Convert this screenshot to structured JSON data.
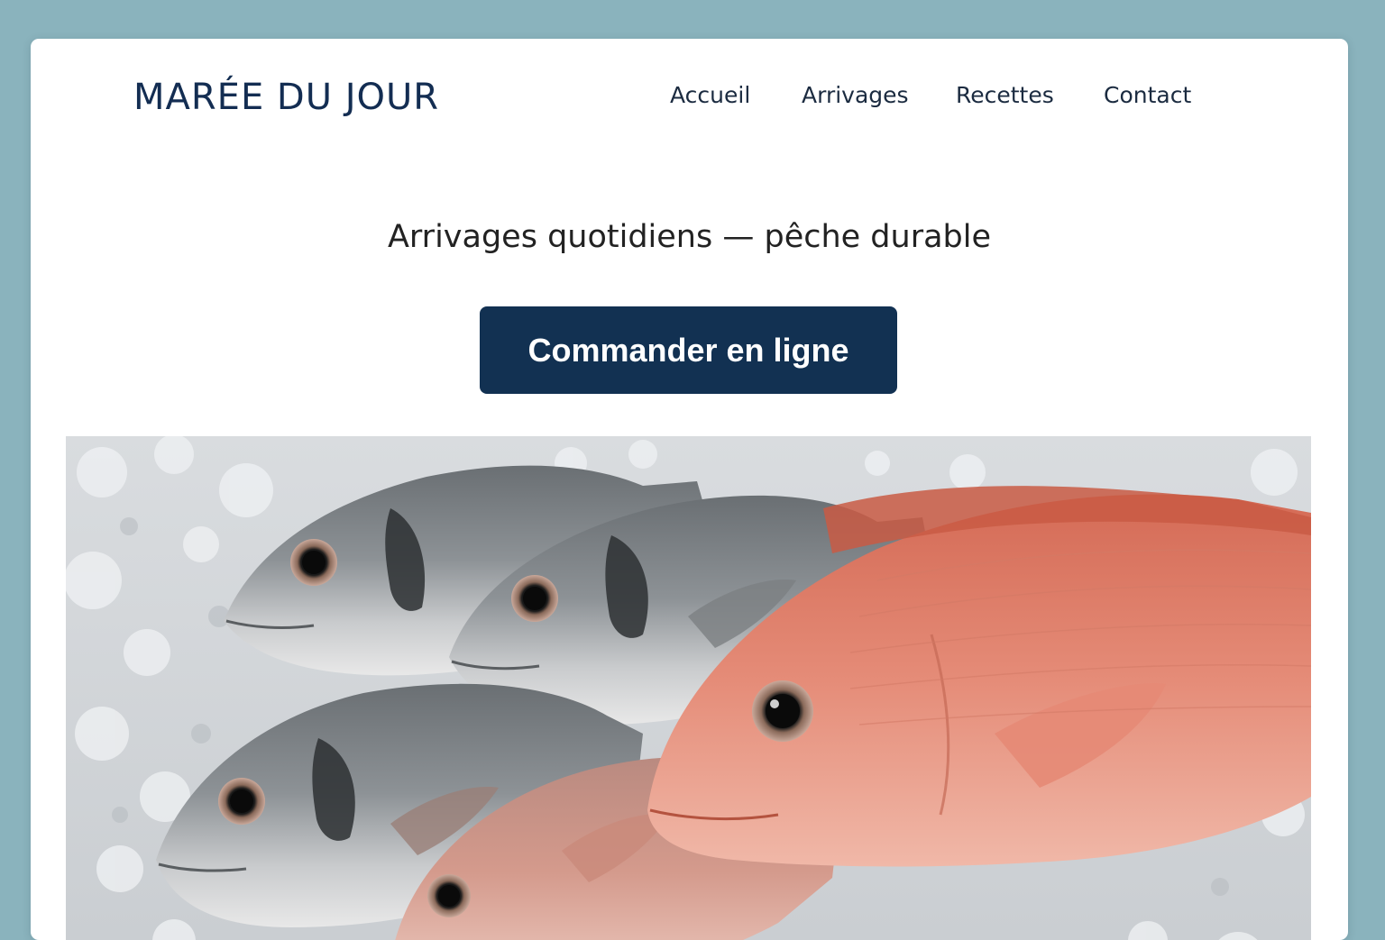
{
  "header": {
    "brand": "MARÉE DU JOUR",
    "nav": [
      {
        "label": "Accueil"
      },
      {
        "label": "Arrivages"
      },
      {
        "label": "Recettes"
      },
      {
        "label": "Contact"
      }
    ]
  },
  "hero": {
    "tagline": "Arrivages quotidiens — pêche durable",
    "cta_label": "Commander en ligne",
    "image": "fresh-fish-on-ice-photo"
  },
  "colors": {
    "page_background": "#8ab3bd",
    "brand_navy": "#123152",
    "card_background": "#ffffff"
  }
}
